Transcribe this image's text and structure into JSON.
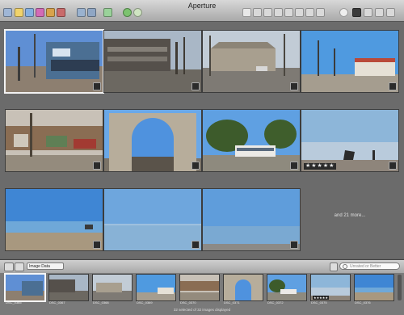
{
  "window": {
    "title": "Aperture"
  },
  "browser": {
    "more_label": "and 21 more...",
    "rating_label": "★★★★★"
  },
  "controlbar": {
    "metadata_select": "Image Data",
    "search_placeholder": "Unrated or Better"
  },
  "filmstrip": {
    "items": [
      {
        "label": "DSC_0365",
        "stars": ""
      },
      {
        "label": "DSC_0367",
        "stars": ""
      },
      {
        "label": "DSC_0368",
        "stars": ""
      },
      {
        "label": "DSC_0369",
        "stars": ""
      },
      {
        "label": "DSC_0370",
        "stars": ""
      },
      {
        "label": "DSC_0371",
        "stars": ""
      },
      {
        "label": "DSC_0372",
        "stars": ""
      },
      {
        "label": "DSC_0375",
        "stars": "★★★★★"
      },
      {
        "label": "DSC_0376",
        "stars": ""
      }
    ],
    "status": "32 selected of 32 images displayed"
  }
}
